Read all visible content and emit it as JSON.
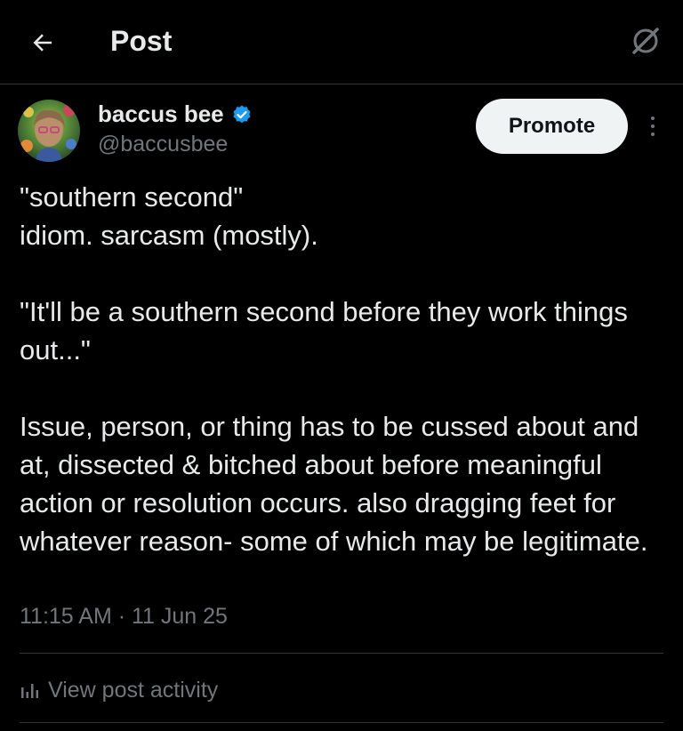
{
  "header": {
    "title": "Post",
    "back_icon": "arrow-left-icon",
    "grok_icon": "grok-icon"
  },
  "author": {
    "name": "baccus bee",
    "handle": "@baccusbee",
    "verified_icon": "verified-badge-icon",
    "verified_color": "#1d9bf0"
  },
  "actions": {
    "promote_label": "Promote",
    "more_icon": "more-vertical-icon"
  },
  "post": {
    "lines": [
      "\"southern second\"",
      "idiom. sarcasm (mostly).",
      "",
      "\"It'll be a southern second before they work things out...\"",
      "",
      "Issue, person, or thing has to be cussed about and at, dissected & bitched about before meaningful action or resolution occurs. also dragging feet for whatever reason- some of which may be legitimate."
    ],
    "timestamp": "11:15 AM · 11 Jun 25"
  },
  "activity": {
    "label": "View post activity",
    "icon": "analytics-icon"
  },
  "colors": {
    "background": "#000000",
    "text": "#e7e9ea",
    "muted": "#71767b",
    "border": "#2f3336",
    "button_bg": "#eff3f4"
  }
}
